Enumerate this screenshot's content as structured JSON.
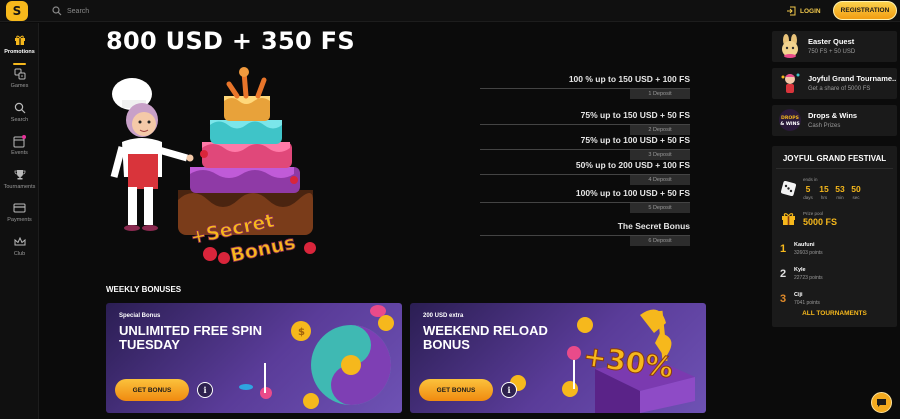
{
  "header": {
    "search_placeholder": "Search",
    "login_label": "LOGIN",
    "registration_label": "REGISTRATION"
  },
  "sidebar": {
    "items": [
      {
        "label": "Promotions",
        "icon": "gift-icon",
        "active": true
      },
      {
        "label": "Games",
        "icon": "dice-icon"
      },
      {
        "label": "Search",
        "icon": "search-icon"
      },
      {
        "label": "Events",
        "icon": "calendar-icon"
      },
      {
        "label": "Tournaments",
        "icon": "trophy-icon"
      },
      {
        "label": "Payments",
        "icon": "card-icon"
      },
      {
        "label": "Club",
        "icon": "crown-icon"
      }
    ]
  },
  "hero": {
    "title": "800 USD + 350 FS",
    "deposits": [
      {
        "text": "100 % up to 150 USD + 100 FS",
        "badge": "1 Deposit"
      },
      {
        "text": "75% up to 150 USD + 50 FS",
        "badge": "2 Deposit"
      },
      {
        "text": "75% up to 100 USD + 50 FS",
        "badge": "3 Deposit"
      },
      {
        "text": "50% up to 200 USD + 100 FS",
        "badge": "4 Deposit"
      },
      {
        "text": "100% up to 100 USD + 50 FS",
        "badge": "5 Deposit"
      },
      {
        "text": "The Secret Bonus",
        "badge": "6 Deposit"
      }
    ],
    "art_text_1": "+Secret",
    "art_text_2": "Bonus"
  },
  "weekly": {
    "title": "WEEKLY BONUSES",
    "cards": [
      {
        "tag": "Special Bonus",
        "title": "UNLIMITED FREE SPIN TUESDAY",
        "button": "GET BONUS",
        "info": "i"
      },
      {
        "tag": "200 USD extra",
        "title": "WEEKEND RELOAD BONUS",
        "button": "GET BONUS",
        "info": "i",
        "art_text": "+30%"
      }
    ]
  },
  "right_panel": {
    "promos": [
      {
        "title": "Easter Quest",
        "subtitle": "750 FS + 50 USD",
        "icon": "bunny-icon"
      },
      {
        "title": "Joyful Grand Tourname...",
        "subtitle": "Get a share of 5000 FS",
        "icon": "mascot-icon"
      },
      {
        "title": "Drops & Wins",
        "subtitle": "Cash Prizes",
        "icon": "drops-wins-icon",
        "icon_text": "DROPS & WINS"
      }
    ],
    "festival": {
      "title": "JOYFUL GRAND FESTIVAL",
      "ends_label": "ends in",
      "countdown": [
        {
          "value": "5",
          "unit": "days"
        },
        {
          "value": "15",
          "unit": "hrs"
        },
        {
          "value": "53",
          "unit": "min"
        },
        {
          "value": "50",
          "unit": "sec"
        }
      ],
      "prize_label": "Prize pool",
      "prize_value": "5000 FS",
      "leaders": [
        {
          "rank": "1",
          "name": "Kaufuni",
          "points": "32603 points"
        },
        {
          "rank": "2",
          "name": "Kyle",
          "points": "22723 points"
        },
        {
          "rank": "3",
          "name": "Ciji",
          "points": "7041 points"
        }
      ],
      "all_label": "ALL TOURNAMENTS"
    }
  },
  "colors": {
    "accent": "#f6b81c",
    "background": "#0b0b0b",
    "panel": "#1a1a1a",
    "card_purple": "#5a3c99"
  }
}
